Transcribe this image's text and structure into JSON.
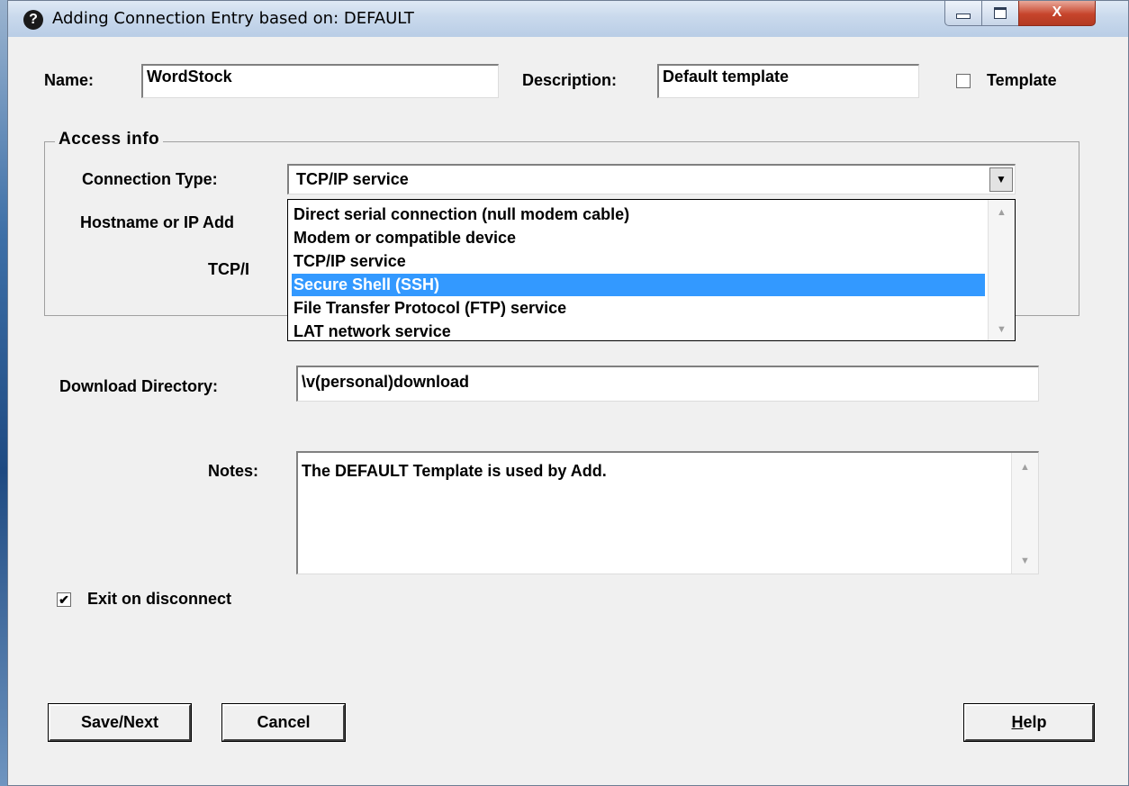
{
  "window": {
    "title": "Adding Connection Entry based on: DEFAULT",
    "help_icon": "?",
    "close_glyph": "X"
  },
  "form": {
    "name_label": "Name:",
    "name_value": "WordStock",
    "description_label": "Description:",
    "description_value": "Default template",
    "template_label": "Template",
    "template_checked": false
  },
  "access_info": {
    "group_title": "Access info",
    "connection_type_label": "Connection Type:",
    "connection_type_value": "TCP/IP service",
    "hostname_label": "Hostname or IP Add",
    "tcp_label": "TCP/I",
    "dropdown_options": [
      {
        "label": "Direct serial connection (null modem cable)",
        "selected": false
      },
      {
        "label": "Modem or compatible device",
        "selected": false
      },
      {
        "label": "TCP/IP service",
        "selected": false
      },
      {
        "label": "Secure Shell (SSH)",
        "selected": true
      },
      {
        "label": "File Transfer Protocol (FTP) service",
        "selected": false
      },
      {
        "label": "LAT network service",
        "selected": false
      }
    ]
  },
  "download": {
    "label": "Download Directory:",
    "value": "\\v(personal)download"
  },
  "notes": {
    "label": "Notes:",
    "value": "The DEFAULT Template is used by Add."
  },
  "exit_on_disconnect": {
    "label": "Exit on disconnect",
    "checked": true,
    "check_glyph": "✔"
  },
  "buttons": {
    "save_next": "Save/Next",
    "cancel": "Cancel",
    "help_first": "H",
    "help_rest": "elp"
  },
  "colors": {
    "selection": "#3399ff",
    "close_button": "#c6442b"
  }
}
